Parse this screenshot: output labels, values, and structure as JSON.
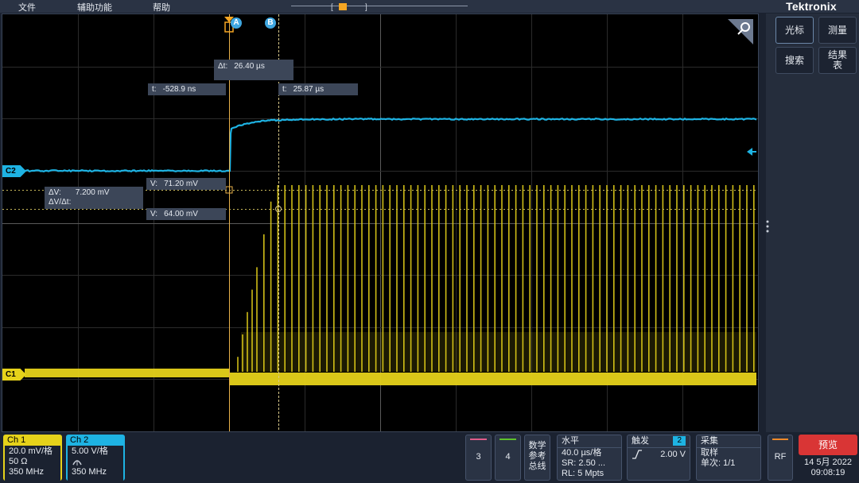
{
  "menu": {
    "file": "文件",
    "assist": "辅助功能",
    "help": "帮助"
  },
  "brand": "Tektronix",
  "right_panel": {
    "cursor": "光标",
    "measure": "测量",
    "search": "搜索",
    "results": "结果表"
  },
  "cursors": {
    "a_label": "A",
    "b_label": "B",
    "delta_t": "Δt:",
    "delta_t_value": "26.40 µs",
    "t_a": "t:",
    "t_a_value": "-528.9 ns",
    "t_b": "t:",
    "t_b_value": "25.87 µs",
    "v_a": "V:",
    "v_a_value": "71.20 mV",
    "v_b": "V:",
    "v_b_value": "64.00 mV",
    "delta_v": "ΔV:",
    "delta_v_value": "7.200 mV",
    "dv_dt": "ΔV/Δt:"
  },
  "channels": {
    "c2_marker": "C2",
    "c1_marker": "C1",
    "ch1": {
      "name": "Ch 1",
      "scale": "20.0 mV/格",
      "impedance": "50 Ω",
      "bandwidth": "350 MHz",
      "color": "#e6d21a"
    },
    "ch2": {
      "name": "Ch 2",
      "scale": "5.00 V/格",
      "bandwidth": "350 MHz",
      "color": "#1eb3e3"
    }
  },
  "buttons": {
    "ch3": "3",
    "ch4": "4",
    "math": "数学 参考 总线",
    "rf": "RF"
  },
  "horizontal": {
    "title": "水平",
    "scale": "40.0 µs/格",
    "sr": "SR: 2.50 ...",
    "rl": "RL: 5 Mpts"
  },
  "trigger": {
    "title": "触发",
    "source": "2",
    "level": "2.00 V"
  },
  "acquire": {
    "title": "采集",
    "mode": "取样",
    "single": "单次: 1/1"
  },
  "preview": {
    "label": "预览"
  },
  "datetime": {
    "date": "14 5月 2022",
    "time": "09:08:19"
  }
}
